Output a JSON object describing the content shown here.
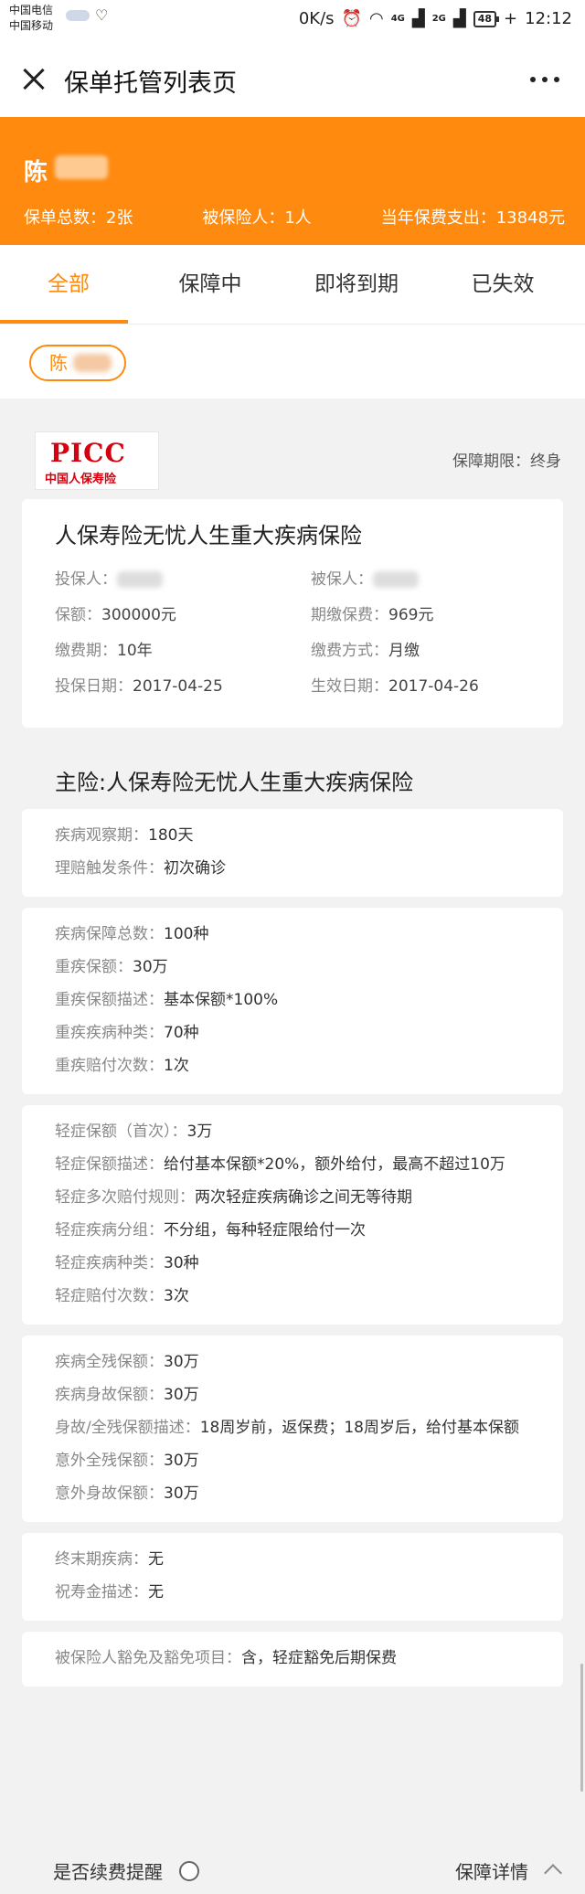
{
  "status_bar": {
    "carrier1": "中国电信",
    "carrier2": "中国移动",
    "speed": "0K/s",
    "network1": "4G",
    "network2": "2G",
    "battery": "48",
    "time": "12:12"
  },
  "titlebar": {
    "title": "保单托管列表页"
  },
  "header": {
    "owner_name": "陈",
    "stats": {
      "total_policies": "保单总数：2张",
      "insured_count": "被保险人：1人",
      "annual_premium": "当年保费支出：13848元"
    },
    "bg_color": "#ff8a0e"
  },
  "tabs": [
    {
      "label": "全部",
      "active": true
    },
    {
      "label": "保障中",
      "active": false
    },
    {
      "label": "即将到期",
      "active": false
    },
    {
      "label": "已失效",
      "active": false
    }
  ],
  "person_chip": "陈",
  "policy": {
    "logo_main": "PICC",
    "logo_sub": "中国人保寿险",
    "term": "保障期限：终身",
    "name": "人保寿险无忧人生重大疾病保险",
    "fields": [
      {
        "label": "投保人：",
        "value": ""
      },
      {
        "label": "被保人：",
        "value": ""
      },
      {
        "label": "保额：",
        "value": "300000元"
      },
      {
        "label": "期缴保费：",
        "value": "969元"
      },
      {
        "label": "缴费期：",
        "value": "10年"
      },
      {
        "label": "缴费方式：",
        "value": "月缴"
      },
      {
        "label": "投保日期：",
        "value": "2017-04-25"
      },
      {
        "label": "生效日期：",
        "value": "2017-04-26"
      }
    ],
    "main_title": "主险:人保寿险无忧人生重大疾病保险",
    "sections": [
      [
        {
          "label": "疾病观察期：",
          "value": "180天"
        },
        {
          "label": "理赔触发条件：",
          "value": "初次确诊"
        }
      ],
      [
        {
          "label": "疾病保障总数：",
          "value": "100种"
        },
        {
          "label": "重疾保额：",
          "value": "30万"
        },
        {
          "label": "重疾保额描述：",
          "value": "基本保额*100%"
        },
        {
          "label": "重疾疾病种类：",
          "value": "70种"
        },
        {
          "label": "重疾赔付次数：",
          "value": "1次"
        }
      ],
      [
        {
          "label": "轻症保额（首次）：",
          "value": "3万"
        },
        {
          "label": "轻症保额描述：",
          "value": "给付基本保额*20%，额外给付，最高不超过10万"
        },
        {
          "label": "轻症多次赔付规则：",
          "value": "两次轻症疾病确诊之间无等待期"
        },
        {
          "label": "轻症疾病分组：",
          "value": "不分组，每种轻症限给付一次"
        },
        {
          "label": "轻症疾病种类：",
          "value": "30种"
        },
        {
          "label": "轻症赔付次数：",
          "value": "3次"
        }
      ],
      [
        {
          "label": "疾病全残保额：",
          "value": "30万"
        },
        {
          "label": "疾病身故保额：",
          "value": "30万"
        },
        {
          "label": "身故/全残保额描述：",
          "value": "18周岁前，返保费；18周岁后，给付基本保额"
        },
        {
          "label": "意外全残保额：",
          "value": "30万"
        },
        {
          "label": "意外身故保额：",
          "value": "30万"
        }
      ],
      [
        {
          "label": "终末期疾病：",
          "value": "无"
        },
        {
          "label": "祝寿金描述：",
          "value": "无"
        }
      ],
      [
        {
          "label": "被保险人豁免及豁免项目：",
          "value": "含，轻症豁免后期保费"
        }
      ]
    ]
  },
  "bottom": {
    "renew_label": "是否续费提醒",
    "detail_label": "保障详情"
  }
}
